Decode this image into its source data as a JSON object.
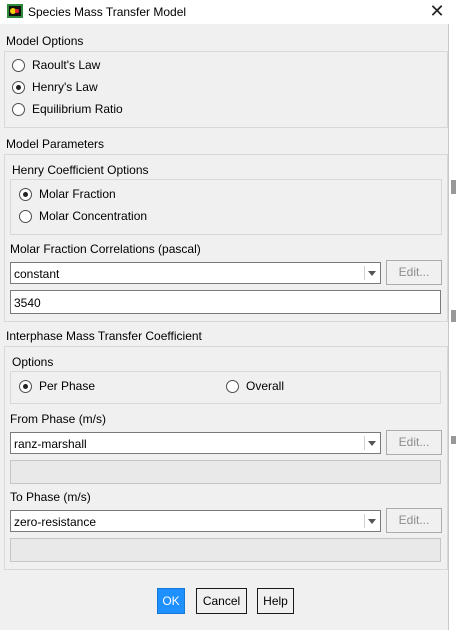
{
  "window": {
    "title": "Species Mass Transfer Model",
    "close_glyph": "✕"
  },
  "model_options": {
    "label": "Model Options",
    "options": [
      "Raoult's Law",
      "Henry's Law",
      "Equilibrium Ratio"
    ],
    "selected": "Henry's Law"
  },
  "model_parameters": {
    "label": "Model Parameters",
    "henry": {
      "label": "Henry Coefficient Options",
      "options": [
        "Molar Fraction",
        "Molar Concentration"
      ],
      "selected": "Molar Fraction"
    },
    "correlations": {
      "label": "Molar Fraction Correlations (pascal)",
      "method": "constant",
      "value": "3540",
      "edit_label": "Edit..."
    }
  },
  "interphase": {
    "label": "Interphase Mass Transfer Coefficient",
    "options_label": "Options",
    "options": [
      "Per Phase",
      "Overall"
    ],
    "selected": "Per Phase",
    "from_phase": {
      "label": "From Phase (m/s)",
      "method": "ranz-marshall",
      "edit_label": "Edit..."
    },
    "to_phase": {
      "label": "To Phase (m/s)",
      "method": "zero-resistance",
      "edit_label": "Edit..."
    }
  },
  "buttons": {
    "ok": "OK",
    "cancel": "Cancel",
    "help": "Help"
  },
  "colors": {
    "accent": "#1e90ff",
    "background": "#f0f0f0",
    "icon_green": "#2e8b3a"
  }
}
